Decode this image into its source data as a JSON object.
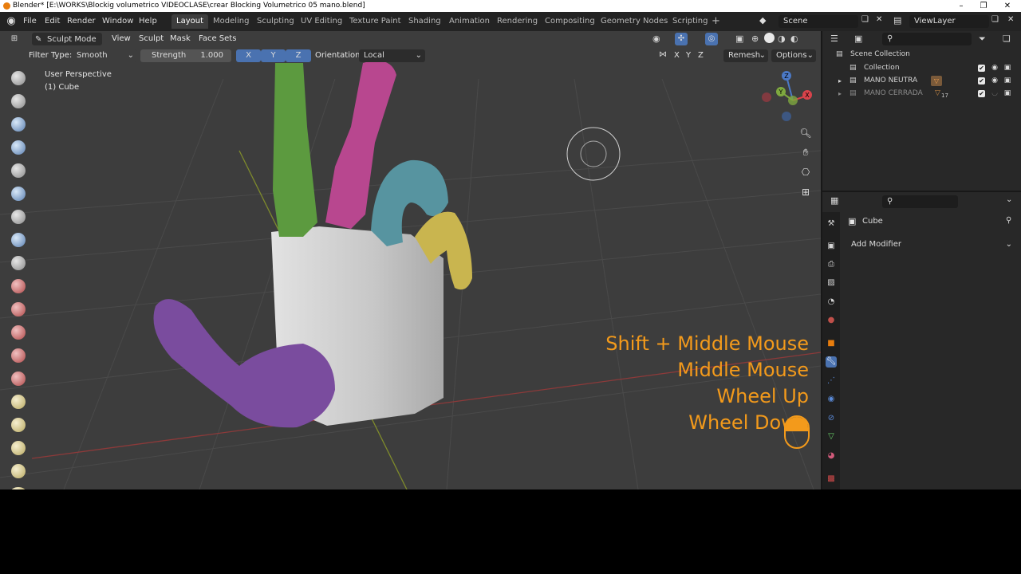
{
  "title_bar": {
    "title": "Blender* [E:\\WORKS\\Blockig volumetrico VIDEOCLASE\\crear Blocking Volumetrico 05 mano.blend]",
    "minimize": "–",
    "maximize": "❐",
    "close": "✕"
  },
  "menu": {
    "file": "File",
    "edit": "Edit",
    "render": "Render",
    "window": "Window",
    "help": "Help"
  },
  "workspaces": [
    "Layout",
    "Modeling",
    "Sculpting",
    "UV Editing",
    "Texture Paint",
    "Shading",
    "Animation",
    "Rendering",
    "Compositing",
    "Geometry Nodes",
    "Scripting"
  ],
  "add_workspace": "+",
  "scene": {
    "label": "Scene"
  },
  "view_layer": {
    "label": "ViewLayer"
  },
  "viewport_header": {
    "mode": "Sculpt Mode",
    "view": "View",
    "sculpt": "Sculpt",
    "mask": "Mask",
    "face_sets": "Face Sets"
  },
  "tool_settings": {
    "filter_type_label": "Filter Type:",
    "filter_type_value": "Smooth",
    "strength_label": "Strength",
    "strength_value": "1.000",
    "axis_x": "X",
    "axis_y": "Y",
    "axis_z": "Z",
    "orientation_label": "Orientation:",
    "orientation_value": "Local",
    "sym_x": "X",
    "sym_y": "Y",
    "sym_z": "Z",
    "remesh": "Remesh",
    "options": "Options"
  },
  "viewport_info": {
    "perspective": "User Perspective",
    "object": "(1) Cube"
  },
  "gizmo": {
    "z": "Z",
    "y": "Y",
    "x": "X"
  },
  "hotkeys": [
    "Shift + Middle Mouse",
    "Middle Mouse",
    "Wheel Up",
    "Wheel Down"
  ],
  "outliner": {
    "scene_collection": "Scene Collection",
    "items": [
      {
        "name": "Collection"
      },
      {
        "name": "MANO NEUTRA"
      },
      {
        "name": "MANO CERRADA",
        "badge": "17"
      }
    ]
  },
  "properties": {
    "object_name": "Cube",
    "add_modifier": "Add Modifier"
  },
  "colors": {
    "orange_accent": "#f39a1b",
    "finger_green": "#5c9a3f",
    "finger_pink": "#b8478f",
    "finger_teal": "#5794a0",
    "finger_yellow": "#c9b54f",
    "finger_purple": "#7a4c9e",
    "palm_gray": "#c9c9c9"
  }
}
